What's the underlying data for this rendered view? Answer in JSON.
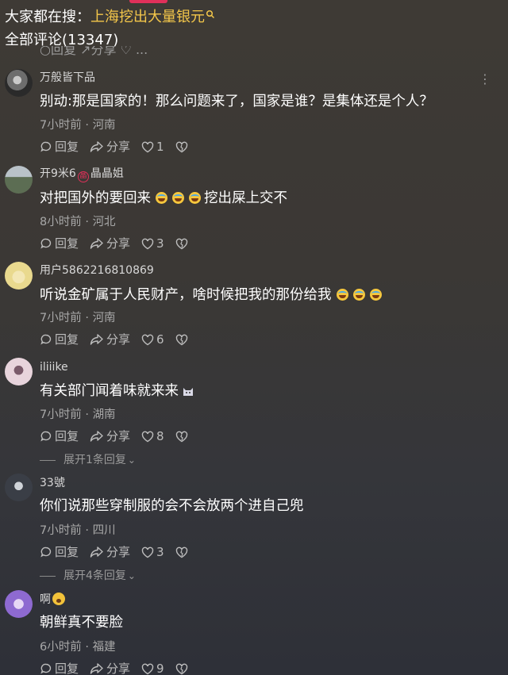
{
  "header": {
    "hot_search_label": "大家都在搜：",
    "hot_search_term": "上海挖出大量银元",
    "search_icon": "search-icon",
    "comment_count_label": "全部评论(13347)",
    "cut_off_row": "○回复 ↗分享 ♡ ..."
  },
  "actions": {
    "reply": "回复",
    "share": "分享"
  },
  "icons": {
    "reply": "comment-bubble-icon",
    "share": "share-arrow-icon",
    "like": "heart-icon",
    "dislike": "broken-heart-icon",
    "more": "more-dots-icon"
  },
  "comments": [
    {
      "username": "万般皆下品",
      "text": "别动:那是国家的！那么问题来了，国家是谁？是集体还是个人？",
      "time": "7小时前",
      "location": "河南",
      "likes": "1"
    },
    {
      "username": "开9米6",
      "badge": "晶",
      "username_suffix": "晶晶姐",
      "text": "对把国外的要回来",
      "text_after": "挖出屎上交不",
      "time": "8小时前",
      "location": "河北",
      "likes": "3"
    },
    {
      "username": "用户5862216810869",
      "text": "听说金矿属于人民财产，啥时候把我的那份给我",
      "time": "7小时前",
      "location": "河南",
      "likes": "6"
    },
    {
      "username": "iliiike",
      "text": "有关部门闻着味就来来",
      "time": "7小时前",
      "location": "湖南",
      "likes": "8",
      "expand": "展开1条回复"
    },
    {
      "username": "33號",
      "text": "你们说那些穿制服的会不会放两个进自己兜",
      "time": "7小时前",
      "location": "四川",
      "likes": "3",
      "expand": "展开4条回复"
    },
    {
      "username": "啊",
      "text": "朝鲜真不要脸",
      "time": "6小时前",
      "location": "福建",
      "likes": "9"
    }
  ],
  "meta_separator": " · ",
  "colors": {
    "accent_link": "#f4c74a",
    "badge_red": "#e0305a",
    "background": "#3b3835"
  }
}
